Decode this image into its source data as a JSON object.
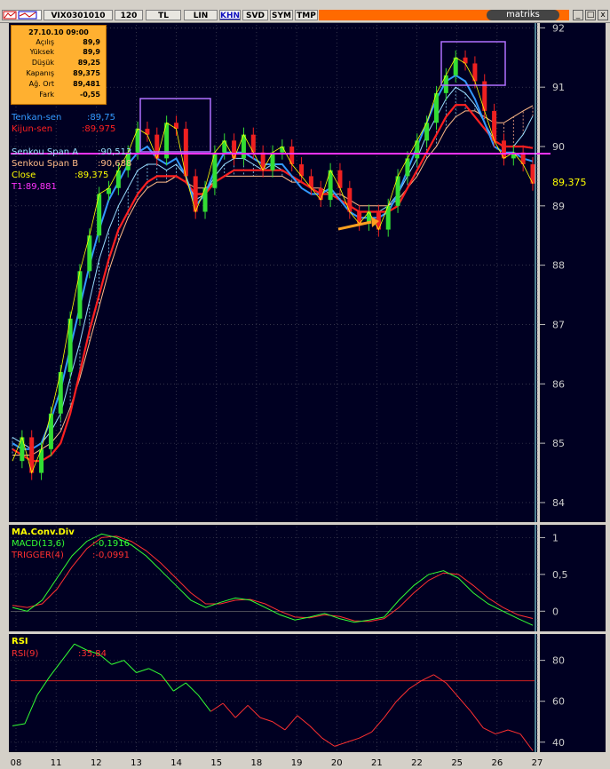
{
  "toolbar": {
    "symbol": "VIX0301010",
    "buttons": [
      "120",
      "TL",
      "LIN",
      "KHN",
      "SVD",
      "SYM",
      "TMP"
    ],
    "active_button": "KHN",
    "brand": "matriks",
    "window_buttons": [
      "_",
      "□",
      "x"
    ],
    "brand_color": "#ff6a00"
  },
  "info_box": {
    "datetime": "27.10.10 09:00",
    "rows": [
      {
        "label": "Açılış",
        "value": "89,9"
      },
      {
        "label": "Yüksek",
        "value": "89,9"
      },
      {
        "label": "Düşük",
        "value": "89,25"
      },
      {
        "label": "Kapanış",
        "value": "89,375"
      },
      {
        "label": "Ağ. Ort",
        "value": "89,481"
      },
      {
        "label": "Fark",
        "value": "-0,55"
      }
    ]
  },
  "legend": [
    {
      "name": "Tenkan-sen",
      "value": ":89,75",
      "color": "#3399ff"
    },
    {
      "name": "Kijun-sen",
      "value": ":89,975",
      "color": "#ff2020"
    },
    {
      "name": "Senkou Span A",
      "value": ":90,513",
      "color": "#99ddff"
    },
    {
      "name": "Senkou Span B",
      "value": ":90,688",
      "color": "#ffbb88"
    },
    {
      "name": "Close",
      "value": ":89,375",
      "color": "#ffff00"
    },
    {
      "name": "T1:89,881",
      "value": "",
      "color": "#ff00ff"
    }
  ],
  "price_label": "89,375",
  "macd_legend": {
    "title": "MA.Conv.Div",
    "macd": {
      "name": "MACD(13,6)",
      "value": ":-0,1916"
    },
    "trigger": {
      "name": "TRIGGER(4)",
      "value": ":-0,0991"
    }
  },
  "rsi_legend": {
    "title": "RSI",
    "rsi": {
      "name": "RSI(9)",
      "value": ":35,84"
    }
  },
  "dates": [
    "08",
    "11",
    "12",
    "13",
    "14",
    "15",
    "18",
    "19",
    "20",
    "21",
    "22",
    "25",
    "26",
    "27"
  ],
  "chart_data": [
    {
      "type": "candlestick",
      "title": "VIX0301010",
      "y_ticks": [
        84,
        85,
        86,
        87,
        88,
        89,
        90,
        91,
        92
      ],
      "ylim": [
        83.7,
        92.05
      ],
      "horizontal_line": 89.881,
      "last_close": 89.375,
      "categories": [
        "08",
        "11",
        "12",
        "13",
        "14",
        "15",
        "18",
        "19",
        "20",
        "21",
        "22",
        "25",
        "26",
        "27"
      ],
      "close_path": [
        84.7,
        85.1,
        84.5,
        84.9,
        85.5,
        86.2,
        87.1,
        87.9,
        88.5,
        89.2,
        89.3,
        89.6,
        89.9,
        90.3,
        90.2,
        89.8,
        90.4,
        90.3,
        89.5,
        88.9,
        89.3,
        89.9,
        90.1,
        89.8,
        90.2,
        89.9,
        89.6,
        89.9,
        90.0,
        89.7,
        89.5,
        89.3,
        89.1,
        89.6,
        89.3,
        88.9,
        88.7,
        88.9,
        88.6,
        89.0,
        89.5,
        89.8,
        90.1,
        90.4,
        90.9,
        91.2,
        91.5,
        91.4,
        91.1,
        90.6,
        90.1,
        89.8,
        89.9,
        89.7,
        89.375
      ],
      "tenkan_path": [
        85.0,
        84.9,
        84.9,
        85.0,
        85.4,
        85.9,
        86.6,
        87.3,
        88.0,
        88.6,
        89.1,
        89.4,
        89.7,
        89.9,
        90.0,
        89.8,
        89.7,
        89.8,
        89.5,
        89.0,
        89.2,
        89.6,
        89.9,
        89.9,
        89.9,
        89.8,
        89.7,
        89.7,
        89.7,
        89.5,
        89.3,
        89.2,
        89.2,
        89.3,
        89.1,
        88.9,
        88.8,
        88.8,
        88.8,
        88.9,
        89.2,
        89.6,
        90.0,
        90.4,
        90.8,
        91.1,
        91.2,
        91.1,
        90.8,
        90.4,
        90.0,
        89.9,
        89.9,
        89.8,
        89.75
      ],
      "kijun_path": [
        84.9,
        84.8,
        84.7,
        84.7,
        84.8,
        85.0,
        85.5,
        86.2,
        86.9,
        87.5,
        88.1,
        88.6,
        88.9,
        89.2,
        89.4,
        89.5,
        89.5,
        89.5,
        89.4,
        89.2,
        89.2,
        89.4,
        89.5,
        89.6,
        89.6,
        89.6,
        89.6,
        89.6,
        89.6,
        89.5,
        89.4,
        89.3,
        89.2,
        89.2,
        89.1,
        89.0,
        88.9,
        88.9,
        88.9,
        88.9,
        89.0,
        89.3,
        89.6,
        89.9,
        90.2,
        90.5,
        90.7,
        90.7,
        90.5,
        90.3,
        90.1,
        90.0,
        90.0,
        90.0,
        89.975
      ],
      "senkou_a_path": [
        85.1,
        85.0,
        84.9,
        85.0,
        85.2,
        85.5,
        86.1,
        86.7,
        87.4,
        88.1,
        88.6,
        89.0,
        89.3,
        89.6,
        89.7,
        89.7,
        89.6,
        89.7,
        89.5,
        89.1,
        89.2,
        89.5,
        89.7,
        89.8,
        89.8,
        89.7,
        89.6,
        89.7,
        89.6,
        89.5,
        89.4,
        89.3,
        89.2,
        89.3,
        89.1,
        89.0,
        88.9,
        88.9,
        88.9,
        89.0,
        89.2,
        89.5,
        89.8,
        90.2,
        90.5,
        90.8,
        91.0,
        90.9,
        90.7,
        90.4,
        90.1,
        90.0,
        90.0,
        90.2,
        90.513
      ],
      "senkou_b_path": [
        84.8,
        84.8,
        84.8,
        84.9,
        85.0,
        85.2,
        85.6,
        86.1,
        86.7,
        87.3,
        87.9,
        88.4,
        88.8,
        89.1,
        89.3,
        89.4,
        89.4,
        89.5,
        89.4,
        89.3,
        89.3,
        89.4,
        89.5,
        89.5,
        89.5,
        89.5,
        89.5,
        89.5,
        89.5,
        89.4,
        89.4,
        89.3,
        89.3,
        89.2,
        89.2,
        89.1,
        89.0,
        89.0,
        89.0,
        89.0,
        89.1,
        89.3,
        89.5,
        89.8,
        90.0,
        90.3,
        90.5,
        90.6,
        90.6,
        90.5,
        90.4,
        90.4,
        90.5,
        90.6,
        90.688
      ]
    },
    {
      "type": "line",
      "title": "MA.Conv.Div",
      "y_ticks": [
        0,
        0.5,
        1
      ],
      "y_tick_labels": [
        "0",
        "0,5",
        "1"
      ],
      "ylim": [
        -0.25,
        1.15
      ],
      "series": [
        {
          "name": "MACD(13,6)",
          "color": "#33ff33",
          "values": [
            0.05,
            0.0,
            0.15,
            0.45,
            0.75,
            0.95,
            1.05,
            1.0,
            0.9,
            0.75,
            0.55,
            0.35,
            0.15,
            0.05,
            0.12,
            0.18,
            0.15,
            0.05,
            -0.05,
            -0.12,
            -0.08,
            -0.03,
            -0.1,
            -0.15,
            -0.12,
            -0.08,
            0.15,
            0.35,
            0.5,
            0.55,
            0.45,
            0.25,
            0.1,
            0.0,
            -0.1,
            -0.1916
          ]
        },
        {
          "name": "TRIGGER(4)",
          "color": "#ff3030",
          "values": [
            0.08,
            0.05,
            0.1,
            0.3,
            0.6,
            0.85,
            1.0,
            1.02,
            0.95,
            0.82,
            0.65,
            0.45,
            0.25,
            0.1,
            0.1,
            0.15,
            0.16,
            0.1,
            0.0,
            -0.08,
            -0.09,
            -0.05,
            -0.07,
            -0.13,
            -0.14,
            -0.1,
            0.05,
            0.25,
            0.42,
            0.52,
            0.5,
            0.35,
            0.18,
            0.05,
            -0.05,
            -0.0991
          ]
        }
      ]
    },
    {
      "type": "line",
      "title": "RSI",
      "y_ticks": [
        40,
        60,
        80
      ],
      "ylim": [
        36,
        92
      ],
      "reference_line": 70,
      "series": [
        {
          "name": "RSI(9)",
          "color": "#33ff33",
          "values": [
            48,
            49,
            63,
            72,
            80,
            88,
            85,
            83,
            78,
            80,
            74,
            76,
            73,
            65,
            69,
            63,
            55,
            59,
            52,
            58,
            52,
            50,
            46,
            53,
            48,
            42,
            38,
            40,
            42,
            45,
            52,
            60,
            66,
            70,
            73,
            69,
            62,
            55,
            47,
            44,
            46,
            44,
            35.84
          ]
        }
      ]
    }
  ]
}
